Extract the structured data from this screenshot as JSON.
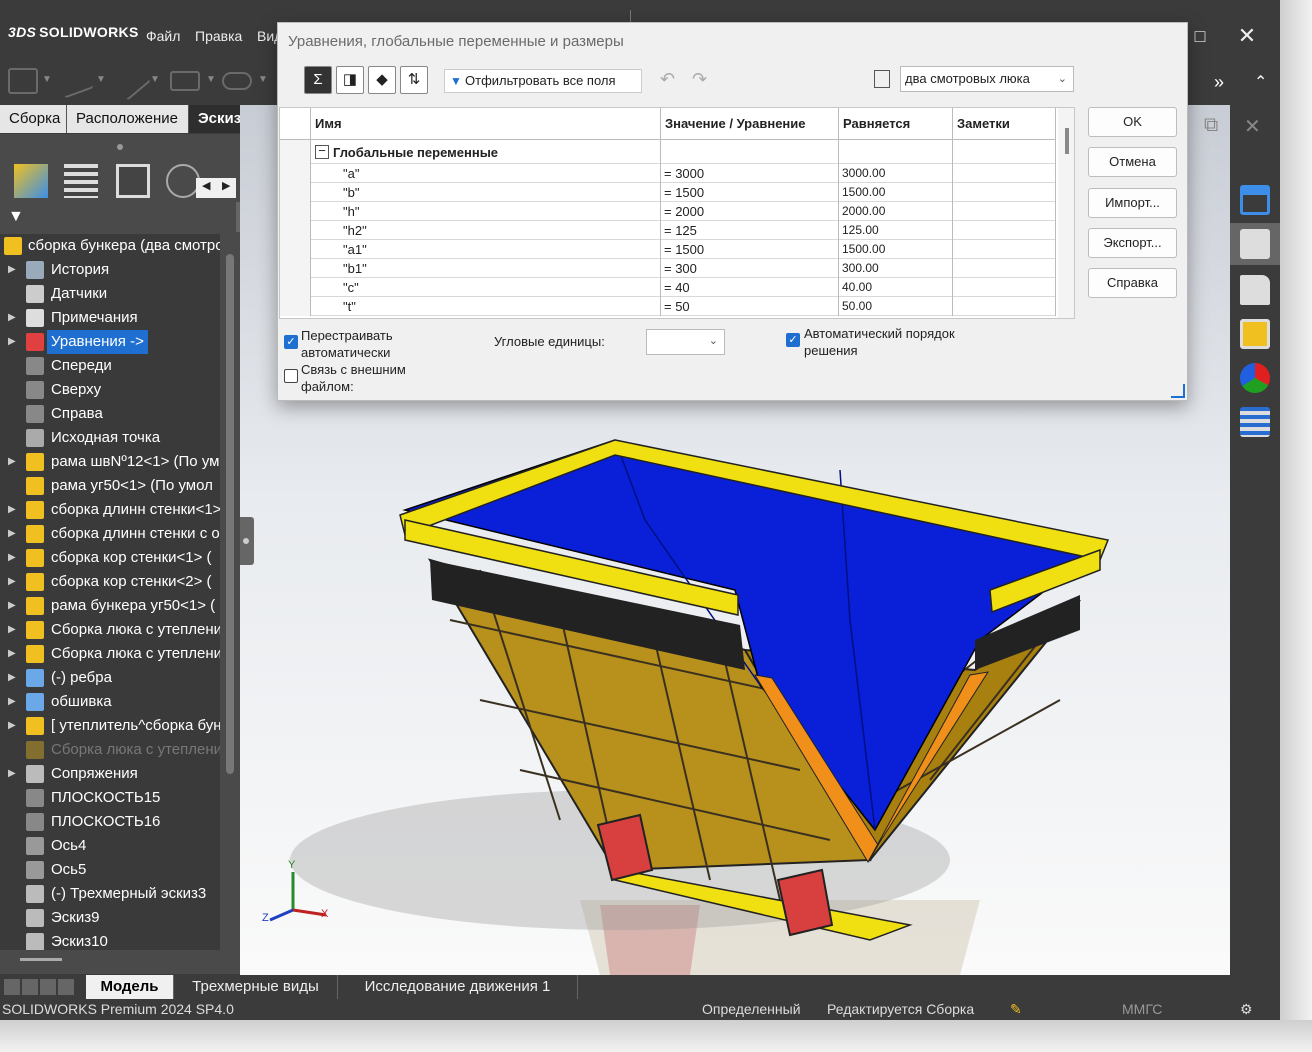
{
  "app": {
    "brand_mark": "3DS",
    "brand_name": "SOLIDWORKS",
    "menus": [
      "Файл",
      "Правка",
      "Вид"
    ]
  },
  "command_tabs": [
    "Сборка",
    "Расположение",
    "Эскиз",
    "Ис"
  ],
  "tree": {
    "root": "сборка бункера (два смотро",
    "items": [
      {
        "label": "История",
        "expandable": true,
        "icon": "history-icon"
      },
      {
        "label": "Датчики",
        "expandable": false,
        "icon": "sensor-icon"
      },
      {
        "label": "Примечания",
        "expandable": true,
        "icon": "annotation-icon"
      },
      {
        "label": "Уравнения ->",
        "expandable": true,
        "icon": "equations-icon",
        "selected": true
      },
      {
        "label": "Спереди",
        "expandable": false,
        "icon": "plane-icon"
      },
      {
        "label": "Сверху",
        "expandable": false,
        "icon": "plane-icon"
      },
      {
        "label": "Справа",
        "expandable": false,
        "icon": "plane-icon"
      },
      {
        "label": "Исходная точка",
        "expandable": false,
        "icon": "origin-icon"
      },
      {
        "label": "рама швNº12<1> (По ум",
        "expandable": true,
        "icon": "part-icon"
      },
      {
        "label": "рама уг50<1> (По умол",
        "expandable": false,
        "icon": "part-icon"
      },
      {
        "label": "сборка длинн стенки<1>",
        "expandable": true,
        "icon": "assembly-icon"
      },
      {
        "label": "сборка длинн стенки с о",
        "expandable": true,
        "icon": "assembly-icon"
      },
      {
        "label": "сборка кор стенки<1> (",
        "expandable": true,
        "icon": "assembly-icon"
      },
      {
        "label": "сборка кор стенки<2> (",
        "expandable": true,
        "icon": "assembly-icon"
      },
      {
        "label": "рама бункера уг50<1> (",
        "expandable": true,
        "icon": "assembly-icon"
      },
      {
        "label": "Сборка люка с утеплени",
        "expandable": true,
        "icon": "assembly-icon"
      },
      {
        "label": "Сборка люка с утеплени",
        "expandable": true,
        "icon": "assembly-icon"
      },
      {
        "label": "(-) ребра",
        "expandable": true,
        "icon": "folder-icon"
      },
      {
        "label": "обшивка",
        "expandable": true,
        "icon": "folder-icon"
      },
      {
        "label": "[ утеплитель^сборка бун",
        "expandable": true,
        "icon": "part-icon"
      },
      {
        "label": "Сборка люка с утеплени",
        "expandable": false,
        "icon": "assembly-icon",
        "dim": true
      },
      {
        "label": "Сопряжения",
        "expandable": true,
        "icon": "mates-icon"
      },
      {
        "label": "ПЛОСКОСТЬ15",
        "expandable": false,
        "icon": "plane-icon"
      },
      {
        "label": "ПЛОСКОСТЬ16",
        "expandable": false,
        "icon": "plane-icon"
      },
      {
        "label": "Ось4",
        "expandable": false,
        "icon": "axis-icon"
      },
      {
        "label": "Ось5",
        "expandable": false,
        "icon": "axis-icon"
      },
      {
        "label": "(-) Трехмерный эскиз3",
        "expandable": false,
        "icon": "sketch3d-icon"
      },
      {
        "label": "Эскиз9",
        "expandable": false,
        "icon": "sketch-icon"
      },
      {
        "label": "Эскиз10",
        "expandable": false,
        "icon": "sketch-icon"
      }
    ]
  },
  "dialog": {
    "title": "Уравнения, глобальные переменные и размеры",
    "filter_label": "Отфильтровать все поля",
    "configuration": "два смотровых люка",
    "columns": [
      "Имя",
      "Значение / Уравнение",
      "Равняется",
      "Заметки"
    ],
    "section": "Глобальные переменные",
    "rows": [
      {
        "name": "\"a\"",
        "equation": "= 3000",
        "value": "3000.00",
        "note": ""
      },
      {
        "name": "\"b\"",
        "equation": "= 1500",
        "value": "1500.00",
        "note": ""
      },
      {
        "name": "\"h\"",
        "equation": "= 2000",
        "value": "2000.00",
        "note": ""
      },
      {
        "name": "\"h2\"",
        "equation": "= 125",
        "value": "125.00",
        "note": ""
      },
      {
        "name": "\"a1\"",
        "equation": "= 1500",
        "value": "1500.00",
        "note": ""
      },
      {
        "name": "\"b1\"",
        "equation": "= 300",
        "value": "300.00",
        "note": ""
      },
      {
        "name": "\"c\"",
        "equation": "= 40",
        "value": "40.00",
        "note": ""
      },
      {
        "name": "\"t\"",
        "equation": "= 50",
        "value": "50.00",
        "note": ""
      }
    ],
    "buttons": {
      "ok": "OK",
      "cancel": "Отмена",
      "import": "Импорт...",
      "export": "Экспорт...",
      "help": "Справка"
    },
    "options": {
      "rebuild_auto": "Перестраивать автоматически",
      "rebuild_auto_checked": true,
      "link_external": "Связь с внешним файлом:",
      "link_external_checked": false,
      "angular_units": "Угловые единицы:",
      "angular_units_value": "",
      "auto_solve": "Автоматический порядок решения",
      "auto_solve_checked": true
    }
  },
  "bottom_tabs": [
    "Модель",
    "Трехмерные виды",
    "Исследование движения 1"
  ],
  "status": {
    "product": "SOLIDWORKS Premium 2024 SP4.0",
    "state": "Определенный",
    "mode": "Редактируется Сборка",
    "units": "ММГС"
  },
  "axes": {
    "x": "X",
    "y": "Y",
    "z": "Z"
  },
  "colors": {
    "dark_ui": "#3b3b3b",
    "selection": "#1e6fd0",
    "hopper_inner": "#0a1fd8",
    "hopper_outer": "#b88a1a",
    "frame_yellow": "#f0e012",
    "edge_orange": "#f0901a",
    "hatch_red": "#d84040"
  }
}
